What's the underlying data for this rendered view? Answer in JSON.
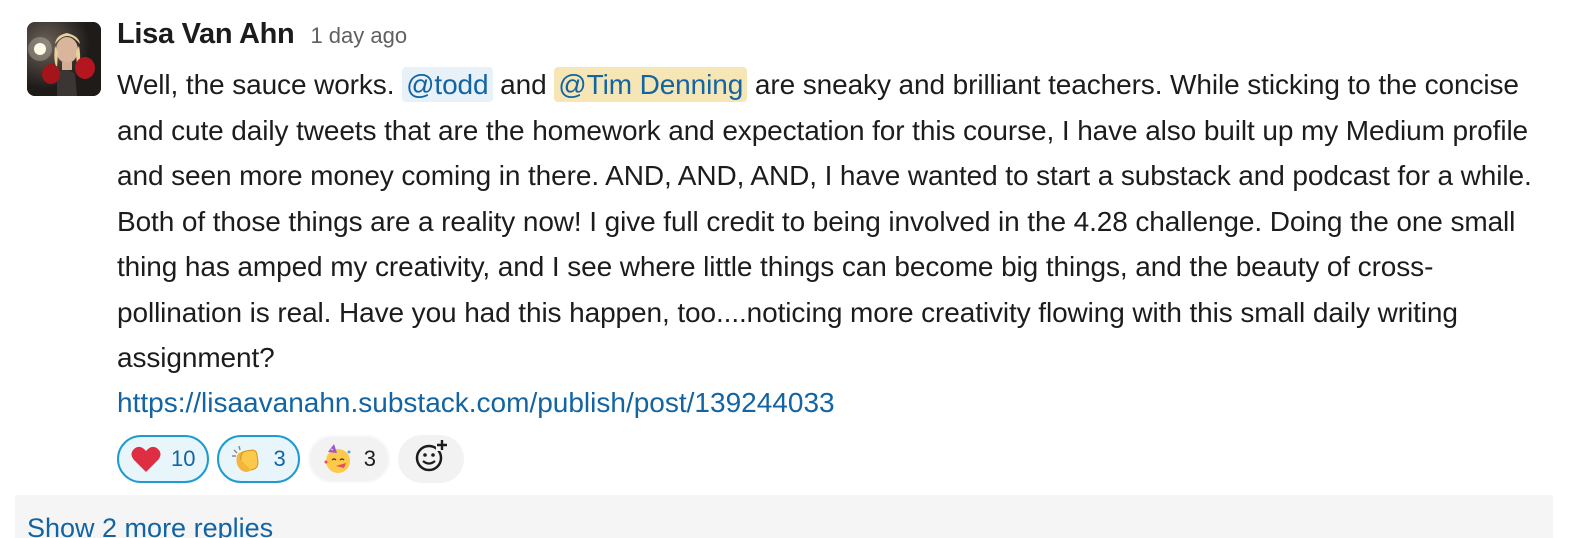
{
  "message": {
    "author": "Lisa Van Ahn",
    "timestamp": "1 day ago",
    "segments": {
      "t1": "Well, the sauce works. ",
      "mention1": "@todd",
      "t2": " and ",
      "mention2": "@Tim Denning",
      "t3": " are sneaky and brilliant teachers. While sticking to the concise and cute daily tweets that are the homework and expectation for this course, I have also built up my Medium profile and seen more money coming in there. AND, AND, AND, I have wanted to start a substack and podcast for a while. Both of those things are a reality now! I give full credit to being involved in the 4.28 challenge. Doing the one small thing has amped my creativity, and I see where little things can become big things, and the beauty of cross-pollination is real. Have you had this happen, too....noticing more creativity flowing with this small daily writing assignment?"
    },
    "link": "https://lisaavanahn.substack.com/publish/post/139244033"
  },
  "reactions": [
    {
      "emoji": "heart-emoji",
      "count": "10",
      "active": true
    },
    {
      "emoji": "clapping-hands-emoji",
      "count": "3",
      "active": true
    },
    {
      "emoji": "partying-face-emoji",
      "count": "3",
      "active": false
    }
  ],
  "add_reaction_icon": "add-reaction-icon",
  "thread": {
    "replies_label": "Show 2 more replies"
  },
  "colors": {
    "link": "#1264a3",
    "mention_bg": "#e8f1f8",
    "mention_highlight_bg": "#f6e6b6",
    "reaction_active_border": "#1d9bd1"
  }
}
